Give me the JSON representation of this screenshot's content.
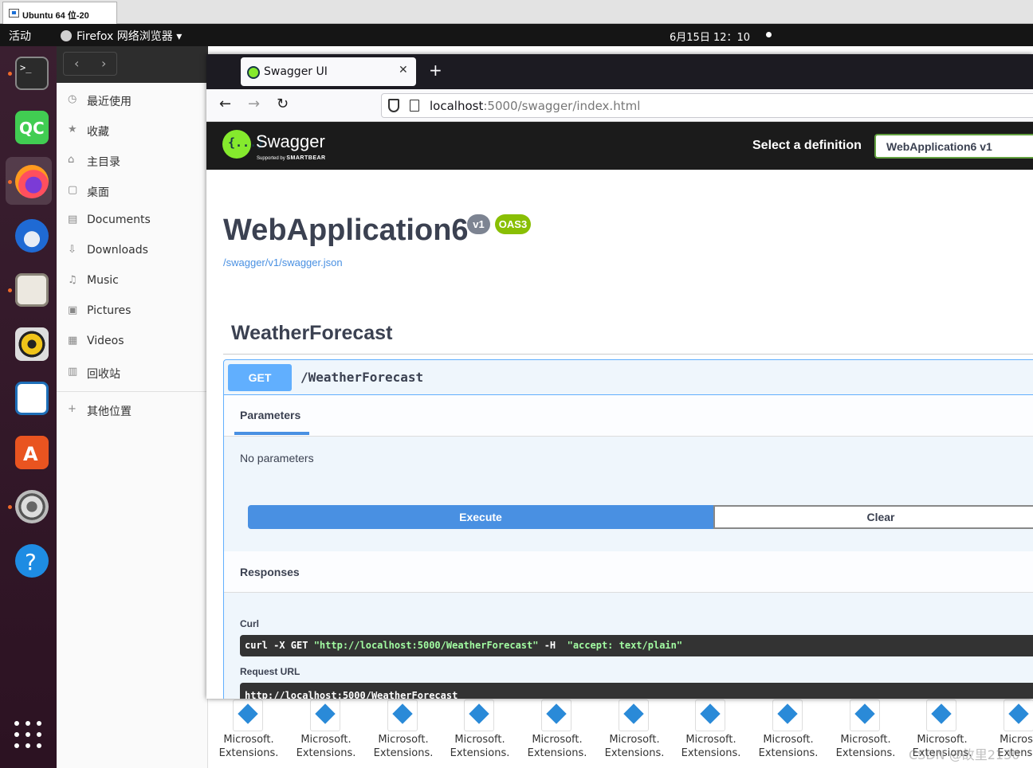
{
  "vm_tab": {
    "label": "Ubuntu 64 位-20"
  },
  "topbar": {
    "activities": "活动",
    "app_menu": "Firefox 网络浏览器 ▾",
    "clock": "6月15日  12：10"
  },
  "dock": {
    "items": [
      "terminal-icon",
      "qc-icon",
      "firefox-icon",
      "thunderbird-icon",
      "files-icon",
      "rhythmbox-icon",
      "writer-icon",
      "software-icon",
      "settings-icon",
      "help-icon",
      "app-grid-icon"
    ]
  },
  "files_sidebar": {
    "nav_back": "‹",
    "nav_forward": "›",
    "items": [
      {
        "icon": "recent-icon",
        "label": "最近使用"
      },
      {
        "icon": "star-icon",
        "label": "收藏"
      },
      {
        "icon": "home-icon",
        "label": "主目录"
      },
      {
        "icon": "desktop-icon",
        "label": "桌面"
      },
      {
        "icon": "document-icon",
        "label": "Documents"
      },
      {
        "icon": "download-icon",
        "label": "Downloads"
      },
      {
        "icon": "music-icon",
        "label": "Music"
      },
      {
        "icon": "picture-icon",
        "label": "Pictures"
      },
      {
        "icon": "video-icon",
        "label": "Videos"
      },
      {
        "icon": "trash-icon",
        "label": "回收站"
      }
    ],
    "other_places": "其他位置"
  },
  "browser": {
    "tab_title": "Swagger UI",
    "tab_close": "✕",
    "new_tab": "+",
    "back": "←",
    "forward": "→",
    "reload": "↻",
    "url_host": "localhost",
    "url_rest": ":5000/swagger/index.html"
  },
  "swagger": {
    "logo_glyph": "{...}",
    "brand": "Swagger",
    "supported_by": "Supported by",
    "smartbear": "SMARTBEAR",
    "select_label": "Select a definition",
    "selected_definition": "WebApplication6 v1",
    "title": "WebApplication6",
    "version_badge": "v1",
    "oas_badge": "OAS3",
    "spec_link": "/swagger/v1/swagger.json",
    "controller": "WeatherForecast",
    "operation": {
      "method": "GET",
      "path": "/WeatherForecast",
      "parameters_heading": "Parameters",
      "no_parameters": "No parameters",
      "execute": "Execute",
      "clear": "Clear",
      "responses_heading": "Responses",
      "curl_label": "Curl",
      "curl_cmd": "curl -X GET ",
      "curl_url": "\"http://localhost:5000/WeatherForecast\"",
      "curl_h": " -H  ",
      "curl_accept": "\"accept: text/plain\"",
      "request_url_label": "Request URL",
      "request_url": "http://localhost:5000/WeatherForecast"
    }
  },
  "desktop_files": [
    {
      "l1": "Microsoft.",
      "l2": "Extensions."
    },
    {
      "l1": "Microsoft.",
      "l2": "Extensions."
    },
    {
      "l1": "Microsoft.",
      "l2": "Extensions."
    },
    {
      "l1": "Microsoft.",
      "l2": "Extensions."
    },
    {
      "l1": "Microsoft.",
      "l2": "Extensions."
    },
    {
      "l1": "Microsoft.",
      "l2": "Extensions."
    },
    {
      "l1": "Microsoft.",
      "l2": "Extensions."
    },
    {
      "l1": "Microsoft.",
      "l2": "Extensions."
    },
    {
      "l1": "Microsoft.",
      "l2": "Extensions."
    },
    {
      "l1": "Microsoft.",
      "l2": "Extensions."
    },
    {
      "l1": "Microso",
      "l2": "Extensio"
    }
  ],
  "watermark": "CSDN @故里2130"
}
